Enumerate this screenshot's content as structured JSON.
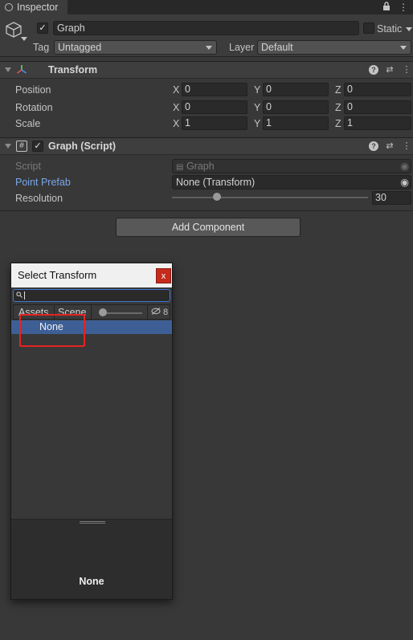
{
  "window": {
    "tab_title": "Inspector",
    "tab_icons": [
      "lock-icon",
      "menu-icon"
    ]
  },
  "header": {
    "object_name": "Graph",
    "active_checked": true,
    "static_label": "Static",
    "tag_label": "Tag",
    "tag_value": "Untagged",
    "layer_label": "Layer",
    "layer_value": "Default"
  },
  "transform": {
    "title": "Transform",
    "rows": [
      {
        "label": "Position",
        "x": "0",
        "y": "0",
        "z": "0"
      },
      {
        "label": "Rotation",
        "x": "0",
        "y": "0",
        "z": "0"
      },
      {
        "label": "Scale",
        "x": "1",
        "y": "1",
        "z": "1"
      }
    ],
    "axis_x": "X",
    "axis_y": "Y",
    "axis_z": "Z"
  },
  "graph_script": {
    "title": "Graph (Script)",
    "enabled": true,
    "script_label": "Script",
    "script_value": "Graph",
    "prefab_label": "Point Prefab",
    "prefab_value": "None (Transform)",
    "resolution_label": "Resolution",
    "resolution_value": "30",
    "resolution_fraction": 0.23
  },
  "add_component_label": "Add Component",
  "popup": {
    "title": "Select Transform",
    "close_glyph": "x",
    "search_placeholder": "",
    "tabs": [
      "Assets",
      "Scene"
    ],
    "hidden_count": "8",
    "selected_item": "None",
    "preview_label": "None"
  },
  "colors": {
    "accent_blue": "#3e5f96",
    "highlight_red": "#e52323",
    "link_blue": "#7aa7e8"
  }
}
